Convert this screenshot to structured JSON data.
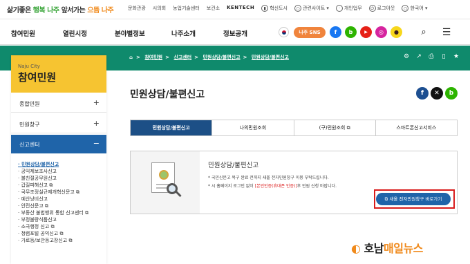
{
  "topbar": {
    "slogan_a": "삶기좋은",
    "slogan_b": "행복",
    "slogan_c": "나주",
    "slogan_d": "앞서가는",
    "slogan_e": "으뜸",
    "slogan_f": "나주",
    "links": [
      "문화관광",
      "시의회",
      "농업기술센터",
      "보건소",
      "KENTECH",
      "혁신도시",
      "관련사이트",
      "개인업무",
      "로그아웃",
      "한국어"
    ]
  },
  "mainnav": {
    "items": [
      "참여민원",
      "열린시정",
      "분야별정보",
      "나주소개",
      "정보공개"
    ],
    "sns_label": "나주 SNS",
    "sns_icons": [
      {
        "name": "facebook-icon",
        "glyph": "f",
        "color": "#1877f2"
      },
      {
        "name": "blog-icon",
        "glyph": "b",
        "color": "#2db400"
      },
      {
        "name": "youtube-icon",
        "glyph": "▶",
        "color": "#e62117"
      },
      {
        "name": "instagram-icon",
        "glyph": "◎",
        "color": "#d6249f"
      },
      {
        "name": "kakao-icon",
        "glyph": "●",
        "color": "#f7d71c"
      }
    ]
  },
  "breadcrumb": [
    "참여민원",
    "신고센터",
    "민원상담/불편신고",
    "민원상담/불편신고"
  ],
  "sidebar": {
    "title_en": "Naju City",
    "title_ko": "참여민원",
    "menus": [
      {
        "label": "종합민원",
        "pm": "+"
      },
      {
        "label": "민원창구",
        "pm": "+"
      },
      {
        "label": "신고센터",
        "pm": "−"
      }
    ],
    "subitems": [
      "민원상담/불편신고",
      "공익제보조사신고",
      "불친절공무원신고",
      "갑질피해신고",
      "국무조정실규제개혁신문고",
      "예산낭비신고",
      "안전신문고",
      "부동산 불법행위 통합 신고센터",
      "부정불량식품신고",
      "소극행정 신고",
      "청렴포털 공익신고",
      "가로등/보안등고장신고"
    ]
  },
  "main": {
    "title": "민원상담/불편신고",
    "tabs": [
      "민원상담/불편신고",
      "나의민원조회",
      "(구)민원조회",
      "스마트폰신고서비스"
    ],
    "box": {
      "title": "민원상담/불편신고",
      "note1": "* 국민신문고 복구 완료 전까지 새올 전자민원창구 이용 부탁드립니다.",
      "note2_a": "* 시 홈페이지 로그인 없이 ",
      "note2_red": "[본인인증(휴대폰 인증)]",
      "note2_b": "후 민원 신청 바랍니다.",
      "button": "새올 전자민원창구 바로가기"
    }
  },
  "watermark": {
    "a": "호남",
    "b": "매일뉴스"
  }
}
